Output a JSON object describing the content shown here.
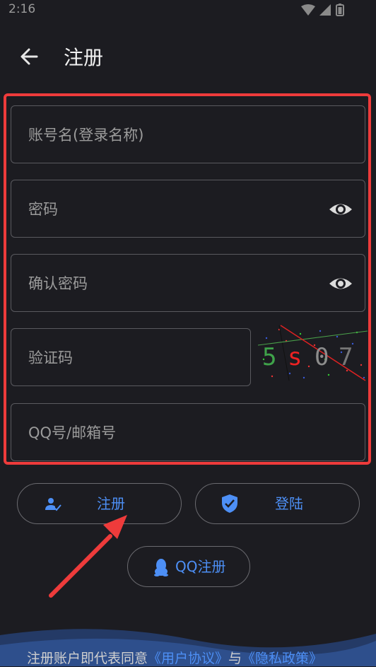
{
  "status_bar": {
    "time": "2:16"
  },
  "header": {
    "title": "注册"
  },
  "form": {
    "account_placeholder": "账号名(登录名称)",
    "password_placeholder": "密码",
    "confirm_placeholder": "确认密码",
    "captcha_placeholder": "验证码",
    "captcha_text": [
      "5",
      "s",
      "0",
      "7"
    ],
    "qq_placeholder": "QQ号/邮箱号"
  },
  "buttons": {
    "register": "注册",
    "login": "登陆",
    "qq_register": "QQ注册"
  },
  "footer": {
    "prefix": "注册账户即代表同意",
    "user_agreement": "《用户协议》",
    "conjunction": "与",
    "privacy_policy": "《隐私政策》"
  },
  "colors": {
    "background": "#1c1c21",
    "accent": "#4d8ff5",
    "highlight": "#ee3b3b"
  }
}
